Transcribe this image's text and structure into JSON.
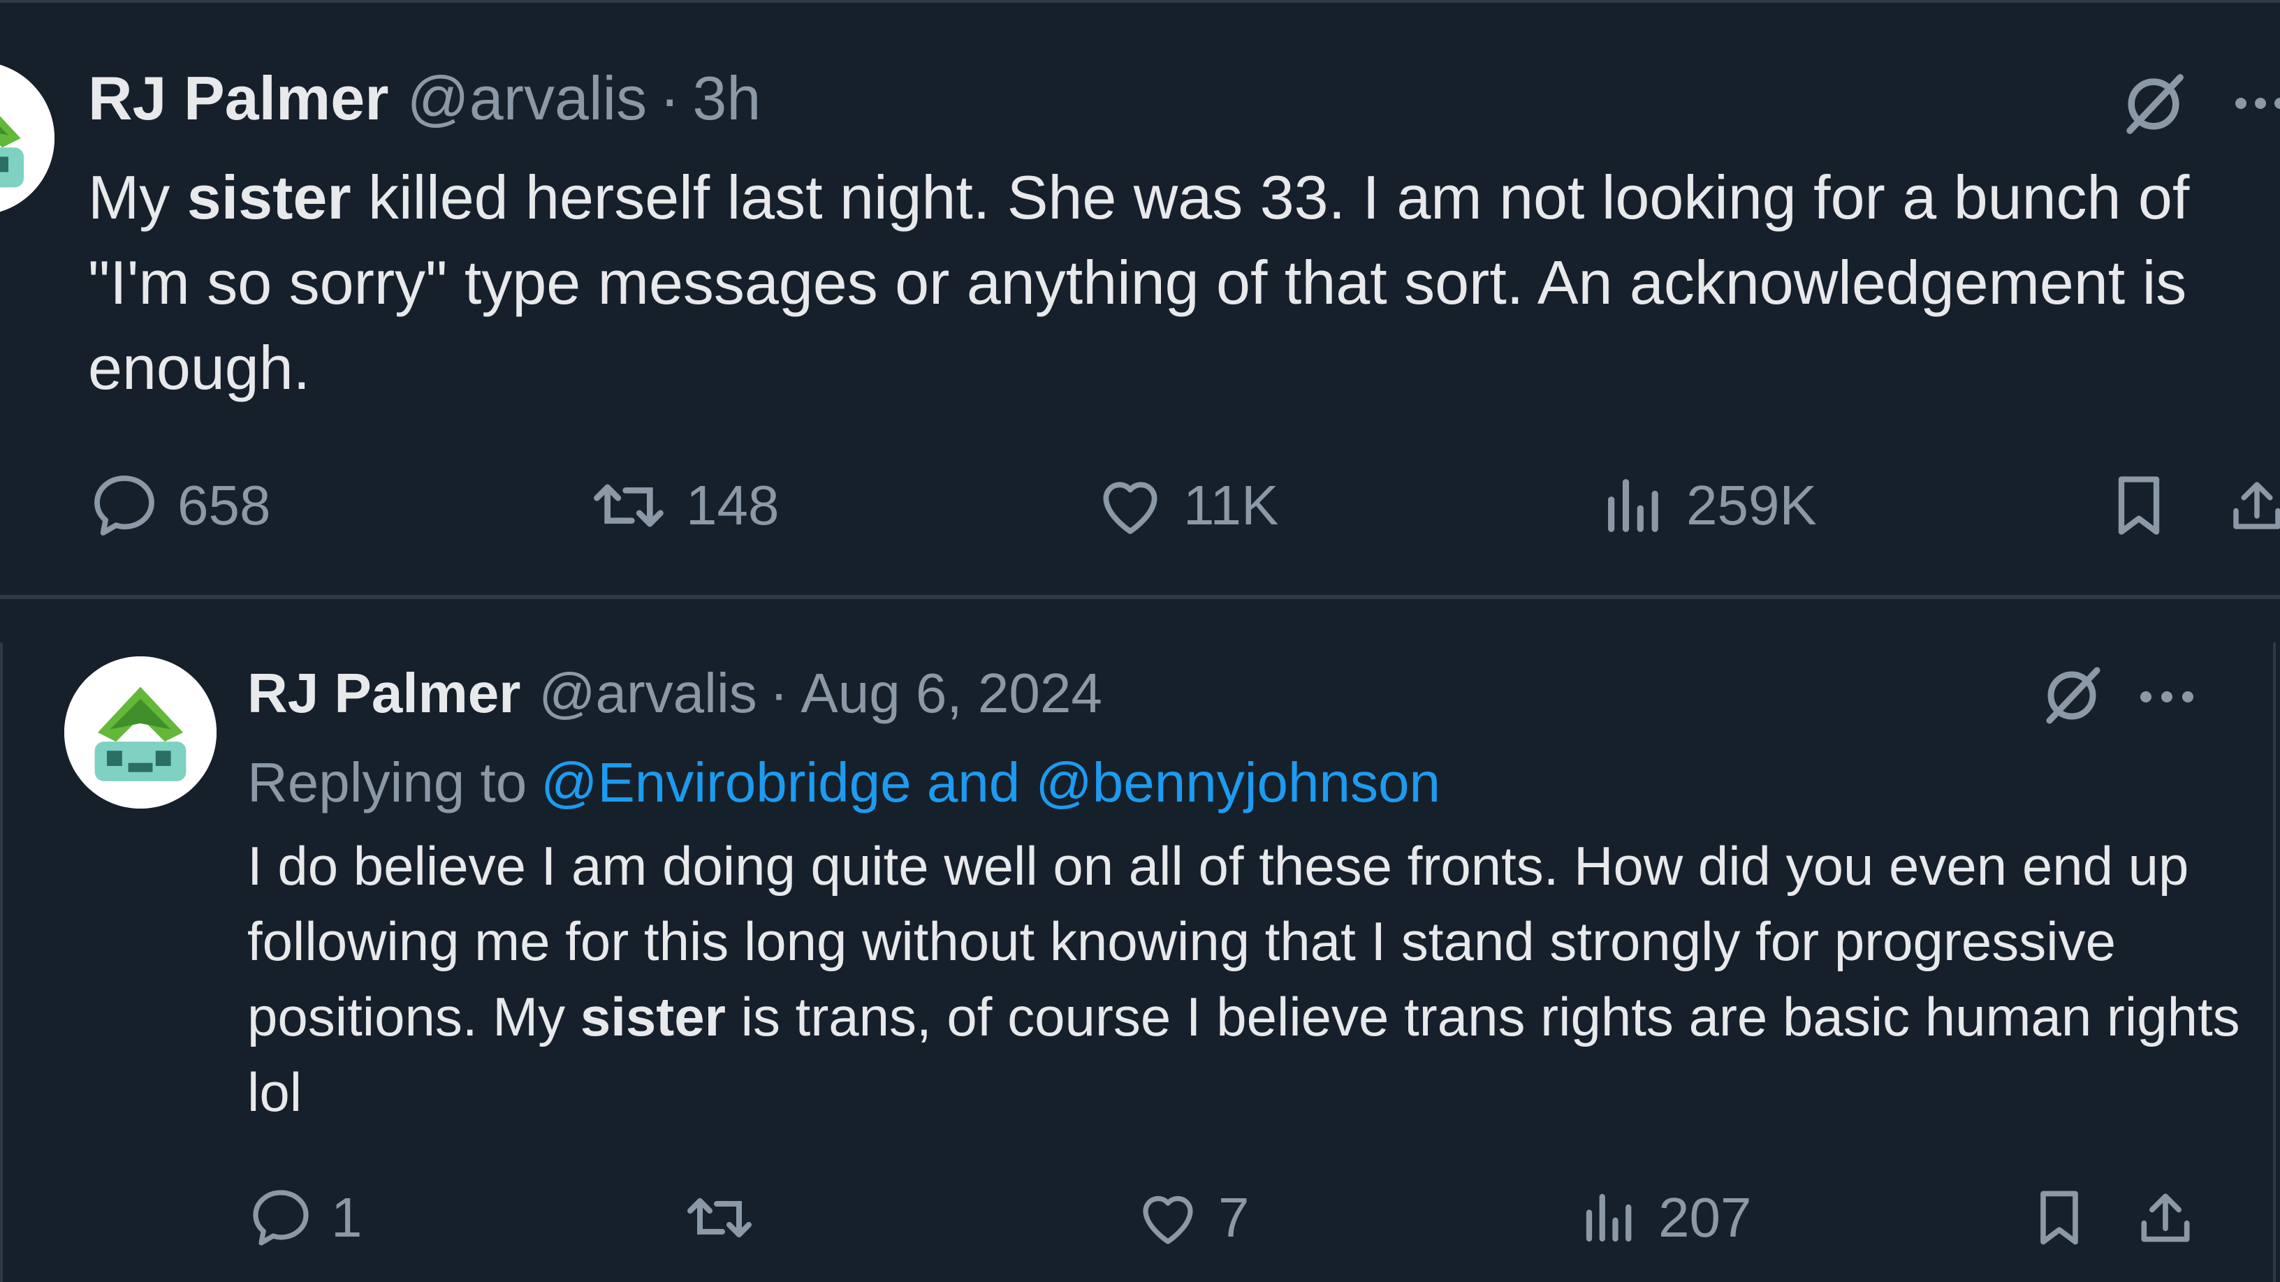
{
  "tweet1": {
    "author_name": "RJ Palmer",
    "handle": "@arvalis",
    "separator": "·",
    "time": "3h",
    "text_before": "My ",
    "text_bold": "sister",
    "text_after": " killed herself last night. She was 33. I am not looking for a bunch of \"I'm so sorry\" type messages or anything of that sort. An acknowledgement is enough.",
    "replies": "658",
    "reposts": "148",
    "likes": "11K",
    "views": "259K"
  },
  "tweet2": {
    "author_name": "RJ Palmer",
    "handle": "@arvalis",
    "separator": "·",
    "time": "Aug 6, 2024",
    "replying_label": "Replying to",
    "replying_to": "@Envirobridge and @bennyjohnson",
    "text_before": "I do believe I am doing quite well on all of these fronts. How did you even end up following me for this long without knowing that I stand strongly for progressive positions. My ",
    "text_bold": "sister",
    "text_after": " is trans, of course I believe trans rights are basic human rights lol",
    "replies": "1",
    "reposts": "",
    "likes": "7",
    "views": "207"
  },
  "colors": {
    "background": "#16202b",
    "text_primary": "#e7e9ea",
    "text_secondary": "#8b98a5",
    "link": "#1d9bf0",
    "divider": "#2f3943",
    "avatar_green": "#63b83a"
  },
  "icons": [
    "reply-icon",
    "repost-icon",
    "like-icon",
    "views-icon",
    "bookmark-icon",
    "share-icon",
    "grok-icon",
    "more-icon"
  ]
}
